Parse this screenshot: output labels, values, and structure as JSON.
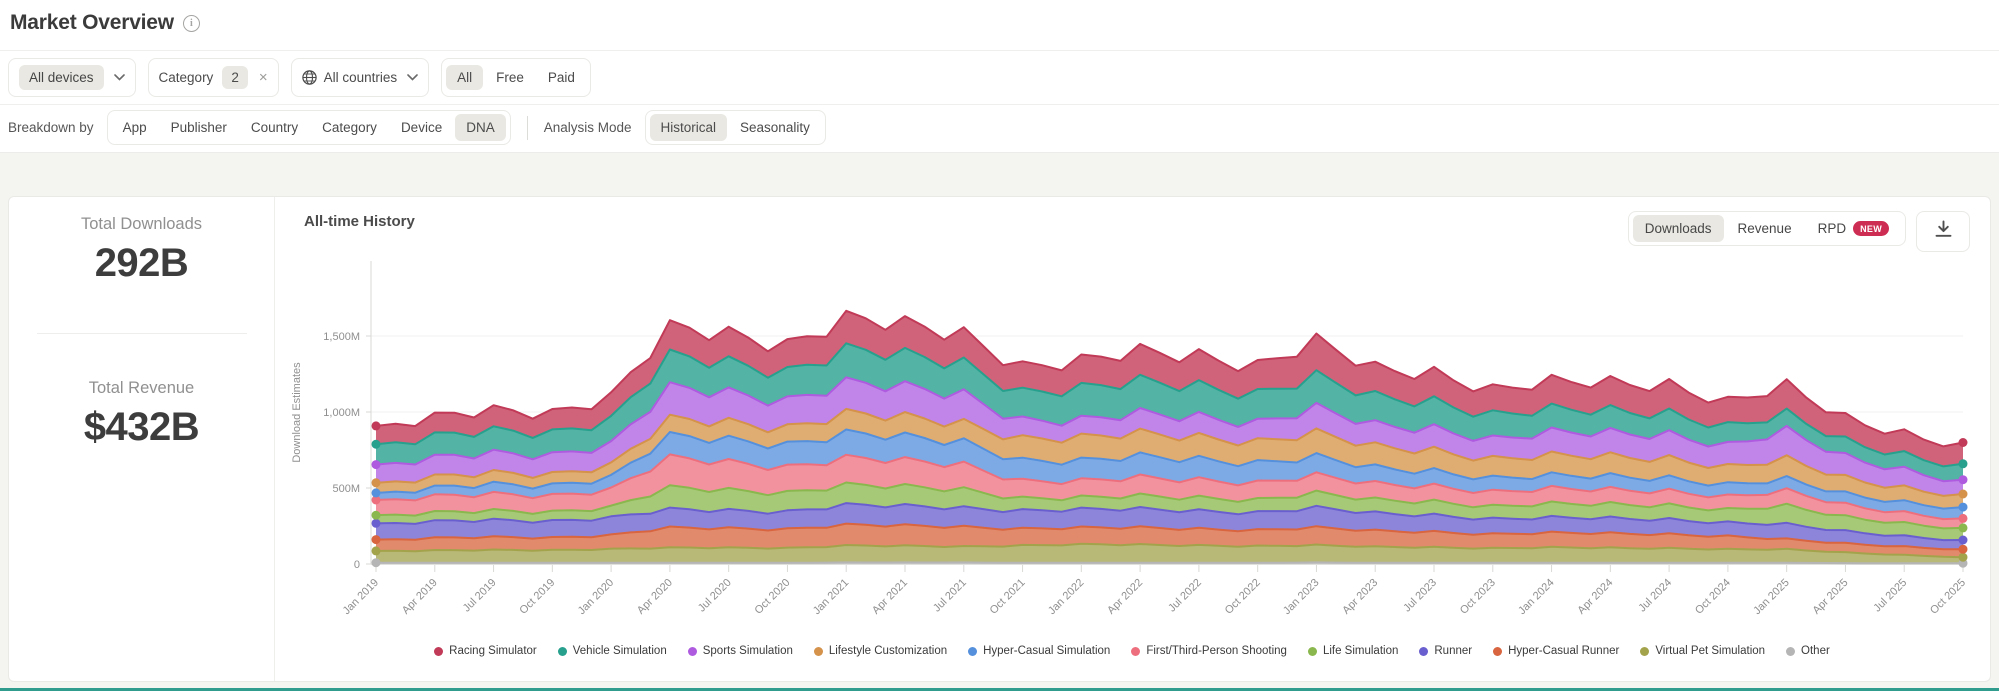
{
  "page": {
    "title": "Market Overview"
  },
  "filters": {
    "devices": {
      "label": "All devices"
    },
    "category": {
      "label": "Category",
      "count": "2",
      "remove": "×"
    },
    "countries": {
      "label": "All countries"
    },
    "pricing": {
      "options": [
        "All",
        "Free",
        "Paid"
      ],
      "selected": "All"
    }
  },
  "breakdown": {
    "label": "Breakdown by",
    "tabs": [
      "App",
      "Publisher",
      "Country",
      "Category",
      "Device",
      "DNA"
    ],
    "selected_tab": "DNA",
    "analysis_label": "Analysis Mode",
    "modes": [
      "Historical",
      "Seasonality"
    ],
    "selected_mode": "Historical"
  },
  "stats": {
    "downloads_label": "Total Downloads",
    "downloads_value": "292B",
    "revenue_label": "Total Revenue",
    "revenue_value": "$432B"
  },
  "chart_header": {
    "title": "All-time History",
    "metrics": [
      "Downloads",
      "Revenue",
      "RPD"
    ],
    "selected_metric": "Downloads",
    "rpd_badge": "NEW"
  },
  "colors": {
    "accent_badge": "#ce2d53",
    "selected_pill": "#e9e8e2",
    "bottom_bar": "#2f9c8e",
    "axis_text": "#8f8f8f",
    "grid": "#f2f2f0"
  },
  "chart_data": {
    "type": "area",
    "stacked": true,
    "title": "All-time History",
    "ylabel": "Download Estimates",
    "yticks": [
      {
        "v": 0,
        "label": "0"
      },
      {
        "v": 500,
        "label": "500M"
      },
      {
        "v": 1000,
        "label": "1,000M"
      },
      {
        "v": 1500,
        "label": "1,500M"
      }
    ],
    "ylim": [
      0,
      1950
    ],
    "unit": "M downloads per month",
    "x_labels": [
      "Jan 2019",
      "Apr 2019",
      "Jul 2019",
      "Oct 2019",
      "Jan 2020",
      "Apr 2020",
      "Jul 2020",
      "Oct 2020",
      "Jan 2021",
      "Apr 2021",
      "Jul 2021",
      "Oct 2021",
      "Jan 2022",
      "Apr 2022",
      "Jul 2022",
      "Oct 2022",
      "Jan 2023",
      "Apr 2023",
      "Jul 2023",
      "Oct 2023",
      "Jan 2024",
      "Apr 2024",
      "Jul 2024",
      "Oct 2024",
      "Jan 2025",
      "Apr 2025",
      "Jul 2025",
      "Oct 2025"
    ],
    "legend_position": "bottom",
    "series": [
      {
        "name": "Racing Simulator",
        "color": "#c13a57",
        "fill": "#d06379",
        "values": [
          117,
          125,
          135,
          132,
          150,
          184,
          190,
          180,
          205,
          200,
          195,
          170,
          179,
          195,
          200,
          185,
          230,
          185,
          190,
          165,
          180,
          185,
          190,
          160,
          184,
          150,
          140,
          134
        ]
      },
      {
        "name": "Vehicle Simulation",
        "color": "#27a08e",
        "fill": "#53b3a4",
        "values": [
          130,
          140,
          150,
          148,
          160,
          206,
          200,
          190,
          215,
          210,
          205,
          185,
          206,
          210,
          205,
          190,
          205,
          185,
          180,
          160,
          150,
          145,
          140,
          125,
          108,
          105,
          100,
          100
        ]
      },
      {
        "name": "Sports Simulation",
        "color": "#ae5be0",
        "fill": "#c184e8",
        "values": [
          117,
          125,
          130,
          128,
          135,
          205,
          195,
          180,
          200,
          195,
          190,
          120,
          113,
          130,
          135,
          125,
          160,
          140,
          145,
          130,
          150,
          155,
          160,
          140,
          184,
          140,
          120,
          90
        ]
      },
      {
        "name": "Lifestyle Customization",
        "color": "#d4924a",
        "fill": "#dfad72",
        "values": [
          64,
          70,
          75,
          74,
          80,
          109,
          115,
          112,
          130,
          128,
          125,
          145,
          151,
          150,
          148,
          140,
          155,
          140,
          138,
          125,
          130,
          132,
          130,
          115,
          130,
          105,
          95,
          82
        ]
      },
      {
        "name": "Hyper-Casual Simulation",
        "color": "#5590dc",
        "fill": "#7daae5",
        "values": [
          46,
          55,
          65,
          68,
          80,
          141,
          150,
          148,
          160,
          155,
          150,
          135,
          130,
          140,
          138,
          130,
          120,
          105,
          100,
          90,
          85,
          88,
          86,
          78,
          76,
          72,
          70,
          71
        ]
      },
      {
        "name": "First/Third-Person Shooting",
        "color": "#ed6f7e",
        "fill": "#f2929e",
        "values": [
          97,
          105,
          110,
          108,
          115,
          194,
          185,
          170,
          175,
          170,
          165,
          115,
          108,
          120,
          118,
          112,
          115,
          105,
          103,
          95,
          98,
          96,
          95,
          85,
          97,
          80,
          70,
          60
        ]
      },
      {
        "name": "Life Simulation",
        "color": "#8ab84e",
        "fill": "#a6c977",
        "values": [
          52,
          58,
          62,
          61,
          68,
          141,
          135,
          125,
          130,
          126,
          122,
          80,
          76,
          85,
          88,
          84,
          95,
          88,
          90,
          82,
          90,
          92,
          94,
          85,
          119,
          95,
          85,
          76
        ]
      },
      {
        "name": "Runner",
        "color": "#6a5fce",
        "fill": "#8d85da",
        "values": [
          104,
          108,
          112,
          110,
          115,
          119,
          118,
          116,
          130,
          128,
          126,
          120,
          119,
          122,
          120,
          115,
          128,
          115,
          112,
          100,
          98,
          100,
          98,
          88,
          98,
          80,
          70,
          58
        ]
      },
      {
        "name": "Hyper-Casual Runner",
        "color": "#d8653f",
        "fill": "#e28a6c",
        "values": [
          72,
          80,
          85,
          83,
          90,
          130,
          128,
          125,
          135,
          132,
          130,
          110,
          108,
          112,
          110,
          105,
          115,
          105,
          102,
          92,
          95,
          96,
          94,
          85,
          65,
          60,
          55,
          50
        ]
      },
      {
        "name": "Virtual Pet Simulation",
        "color": "#a3a34c",
        "fill": "#b8b877",
        "values": [
          76,
          80,
          85,
          84,
          90,
          98,
          100,
          98,
          110,
          108,
          106,
          115,
          120,
          118,
          115,
          110,
          112,
          105,
          103,
          95,
          100,
          98,
          96,
          88,
          87,
          70,
          55,
          38
        ]
      },
      {
        "name": "Other",
        "color": "#b5b5b5",
        "fill": "#c9c9c9",
        "values": [
          8,
          8,
          8,
          8,
          8,
          8,
          8,
          8,
          10,
          10,
          10,
          8,
          8,
          8,
          8,
          8,
          10,
          8,
          8,
          8,
          8,
          8,
          8,
          8,
          8,
          6,
          5,
          5
        ]
      }
    ]
  }
}
